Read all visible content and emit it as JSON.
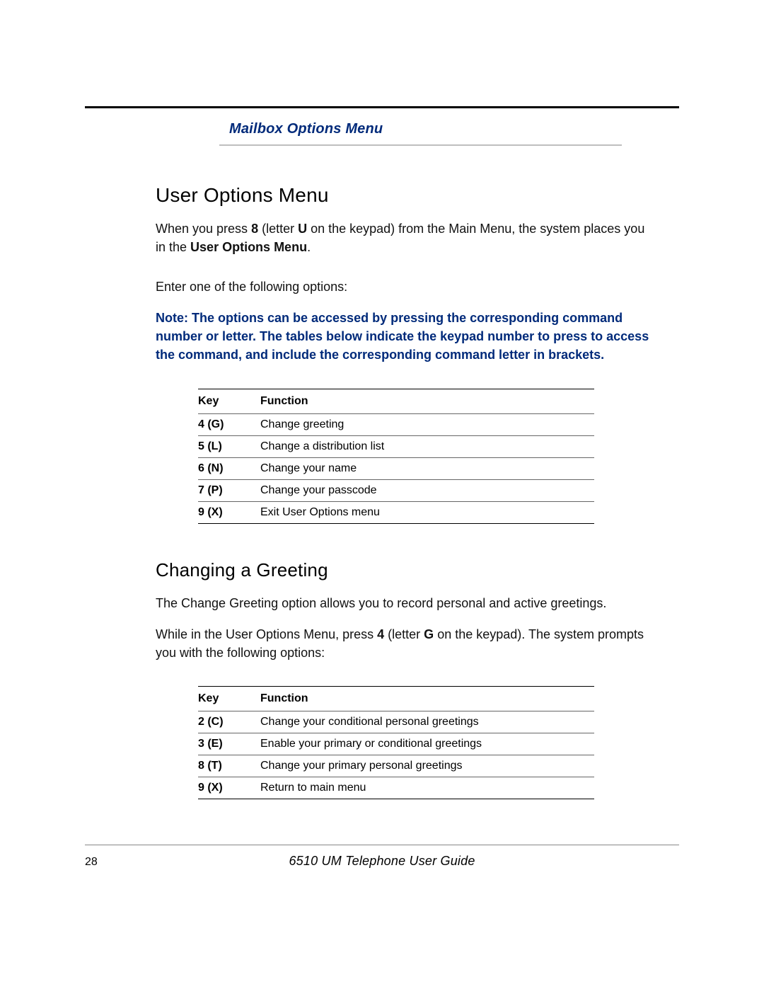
{
  "header": {
    "tab_title": "Mailbox Options Menu"
  },
  "section1": {
    "heading": "User Options Menu",
    "p1_a": "When you press ",
    "p1_b": "8",
    "p1_c": " (letter ",
    "p1_d": "U",
    "p1_e": " on the keypad) from the Main Menu, the system places you in the ",
    "p1_f": "User Options Menu",
    "p1_g": ".",
    "p2": "Enter one of the following options:",
    "note": "Note: The options can be accessed by pressing the corresponding command number or letter. The tables below indicate the keypad number to press to access the command, and include the corresponding command letter in brackets.",
    "table": {
      "th_key": "Key",
      "th_fn": "Function",
      "rows": [
        {
          "key": "4 (G)",
          "fn": "Change greeting"
        },
        {
          "key": "5 (L)",
          "fn": "Change a distribution list"
        },
        {
          "key": "6 (N)",
          "fn": "Change your name"
        },
        {
          "key": "7 (P)",
          "fn": "Change your passcode"
        },
        {
          "key": "9 (X)",
          "fn": "Exit User Options menu"
        }
      ]
    }
  },
  "section2": {
    "heading": "Changing a Greeting",
    "p1": "The Change Greeting option allows you to record personal and active greetings.",
    "p2_a": "While  in the User Options Menu, press ",
    "p2_b": "4",
    "p2_c": " (letter ",
    "p2_d": "G",
    "p2_e": " on the keypad). The system prompts you with the following options:",
    "table": {
      "th_key": "Key",
      "th_fn": "Function",
      "rows": [
        {
          "key": "2 (C)",
          "fn": "Change your conditional personal greetings"
        },
        {
          "key": "3 (E)",
          "fn": "Enable your primary or conditional greetings"
        },
        {
          "key": "8 (T)",
          "fn": "Change your primary personal greetings"
        },
        {
          "key": "9 (X)",
          "fn": "Return to main menu"
        }
      ]
    }
  },
  "footer": {
    "page": "28",
    "title": "6510 UM Telephone User Guide"
  }
}
